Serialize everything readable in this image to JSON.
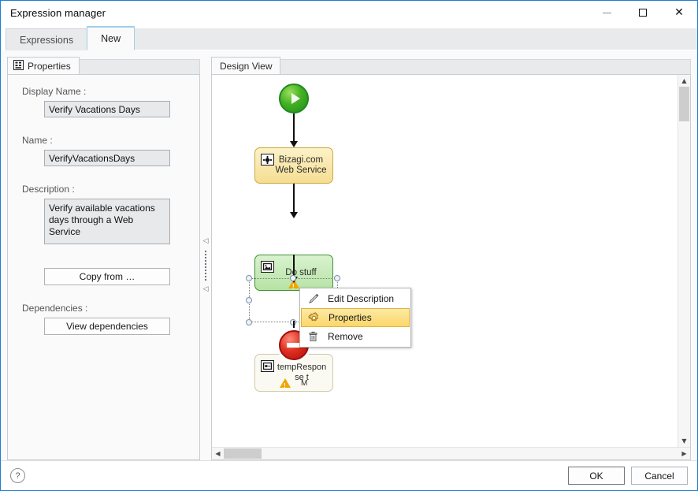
{
  "window": {
    "title": "Expression manager",
    "controls": {
      "minimize": "–",
      "maximize": "□",
      "close": "✕"
    }
  },
  "tabs": [
    {
      "label": "Expressions",
      "active": false
    },
    {
      "label": "New",
      "active": true
    }
  ],
  "properties_panel": {
    "tab_label": "Properties",
    "fields": [
      {
        "label": "Display Name :",
        "value": "Verify Vacations Days"
      },
      {
        "label": "Name :",
        "value": "VerifyVacationsDays"
      },
      {
        "label": "Description :",
        "value": "Verify available vacations days through a Web Service"
      }
    ],
    "copy_from_button": "Copy from …",
    "dependencies_label": "Dependencies :",
    "view_dependencies_button": "View dependencies"
  },
  "design_view": {
    "tab_label": "Design View",
    "nodes": [
      {
        "id": "start",
        "type": "start-event",
        "label": ""
      },
      {
        "id": "bizagi",
        "type": "task",
        "label": "Bizagi.com\nWeb Service",
        "label_line1": "Bizagi.com",
        "label_line2": "Web Service",
        "color": "#f5dd92",
        "warning": false
      },
      {
        "id": "dostuff",
        "type": "task",
        "label": "Do stuff",
        "color": "#b6e3a4",
        "warning": true
      },
      {
        "id": "tempresponse",
        "type": "task",
        "label_line1": "tempRespon",
        "label_line2": "se t",
        "label_line3": "M",
        "color": "#fbfaf2",
        "warning": true,
        "selected": true
      },
      {
        "id": "end",
        "type": "end-event",
        "label": ""
      }
    ]
  },
  "context_menu": {
    "items": [
      {
        "label": "Edit Description",
        "icon": "pencil-icon",
        "highlighted": false
      },
      {
        "label": "Properties",
        "icon": "gear-icon",
        "highlighted": true
      },
      {
        "label": "Remove",
        "icon": "trash-icon",
        "highlighted": false
      }
    ]
  },
  "footer": {
    "help_glyph": "?",
    "ok_button": "OK",
    "cancel_button": "Cancel"
  },
  "colors": {
    "accent": "#1a7fd4",
    "highlight": "#fbd76a",
    "start_event": "#43b024",
    "end_event": "#e03020",
    "warning": "#f0a500"
  }
}
